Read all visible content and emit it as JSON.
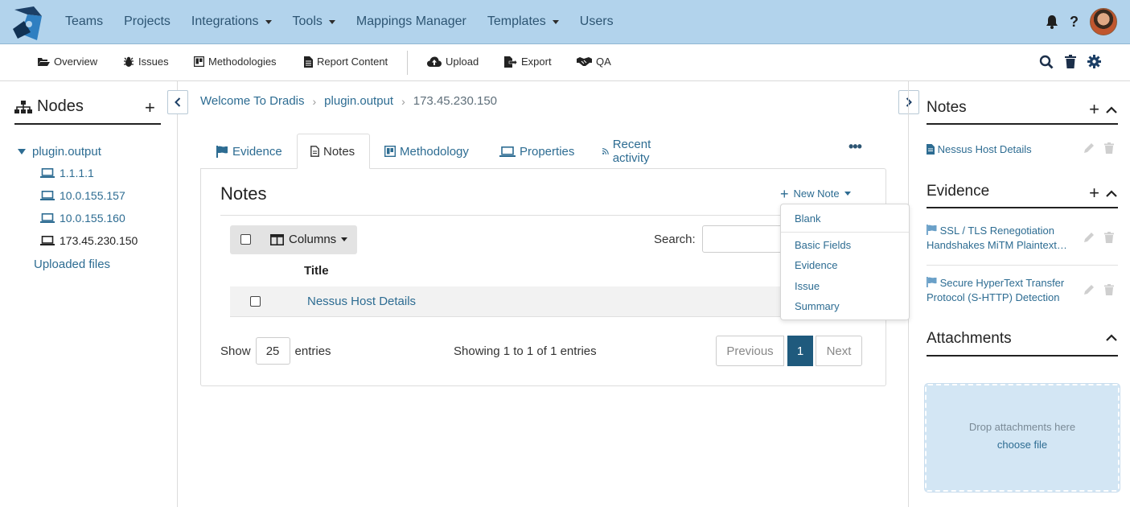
{
  "topnav": {
    "items": [
      {
        "label": "Teams",
        "dropdown": false
      },
      {
        "label": "Projects",
        "dropdown": false
      },
      {
        "label": "Integrations",
        "dropdown": true
      },
      {
        "label": "Tools",
        "dropdown": true
      },
      {
        "label": "Mappings Manager",
        "dropdown": false
      },
      {
        "label": "Templates",
        "dropdown": true
      },
      {
        "label": "Users",
        "dropdown": false
      }
    ],
    "help_label": "?"
  },
  "toolbar": {
    "overview": "Overview",
    "issues": "Issues",
    "methodologies": "Methodologies",
    "report_content": "Report Content",
    "upload": "Upload",
    "export": "Export",
    "qa": "QA"
  },
  "nodes_panel": {
    "title": "Nodes",
    "add_label": "+",
    "root": "plugin.output",
    "children": [
      "1.1.1.1",
      "10.0.155.157",
      "10.0.155.160",
      "173.45.230.150"
    ],
    "uploaded": "Uploaded files"
  },
  "breadcrumb": [
    "Welcome To Dradis",
    "plugin.output",
    "173.45.230.150"
  ],
  "tabs": [
    "Evidence",
    "Notes",
    "Methodology",
    "Properties",
    "Recent activity"
  ],
  "more_label": "•••",
  "notes_panel": {
    "title": "Notes",
    "new_note": "New Note",
    "columns": "Columns",
    "search_label": "Search:",
    "search_value": "",
    "column_header": "Title",
    "rows": [
      "Nessus Host Details"
    ],
    "show_label": "Show",
    "entries_label": "entries",
    "page_size": "25",
    "showing": "Showing 1 to 1 of 1 entries",
    "prev": "Previous",
    "page": "1",
    "next": "Next"
  },
  "new_note_menu": {
    "blank": "Blank",
    "items": [
      "Basic Fields",
      "Evidence",
      "Issue",
      "Summary"
    ]
  },
  "right_panel": {
    "notes_title": "Notes",
    "notes": [
      "Nessus Host Details"
    ],
    "evidence_title": "Evidence",
    "evidence": [
      "SSL / TLS Renegotiation Handshakes MiTM Plaintext…",
      "Secure HyperText Transfer Protocol (S-HTTP) Detection"
    ],
    "attachments_title": "Attachments",
    "drop_text": "Drop attachments here",
    "choose_file": "choose file"
  },
  "colors": {
    "topbar": "#b2d3ec",
    "link": "#2d6c92",
    "active_page": "#1f5a7d"
  }
}
